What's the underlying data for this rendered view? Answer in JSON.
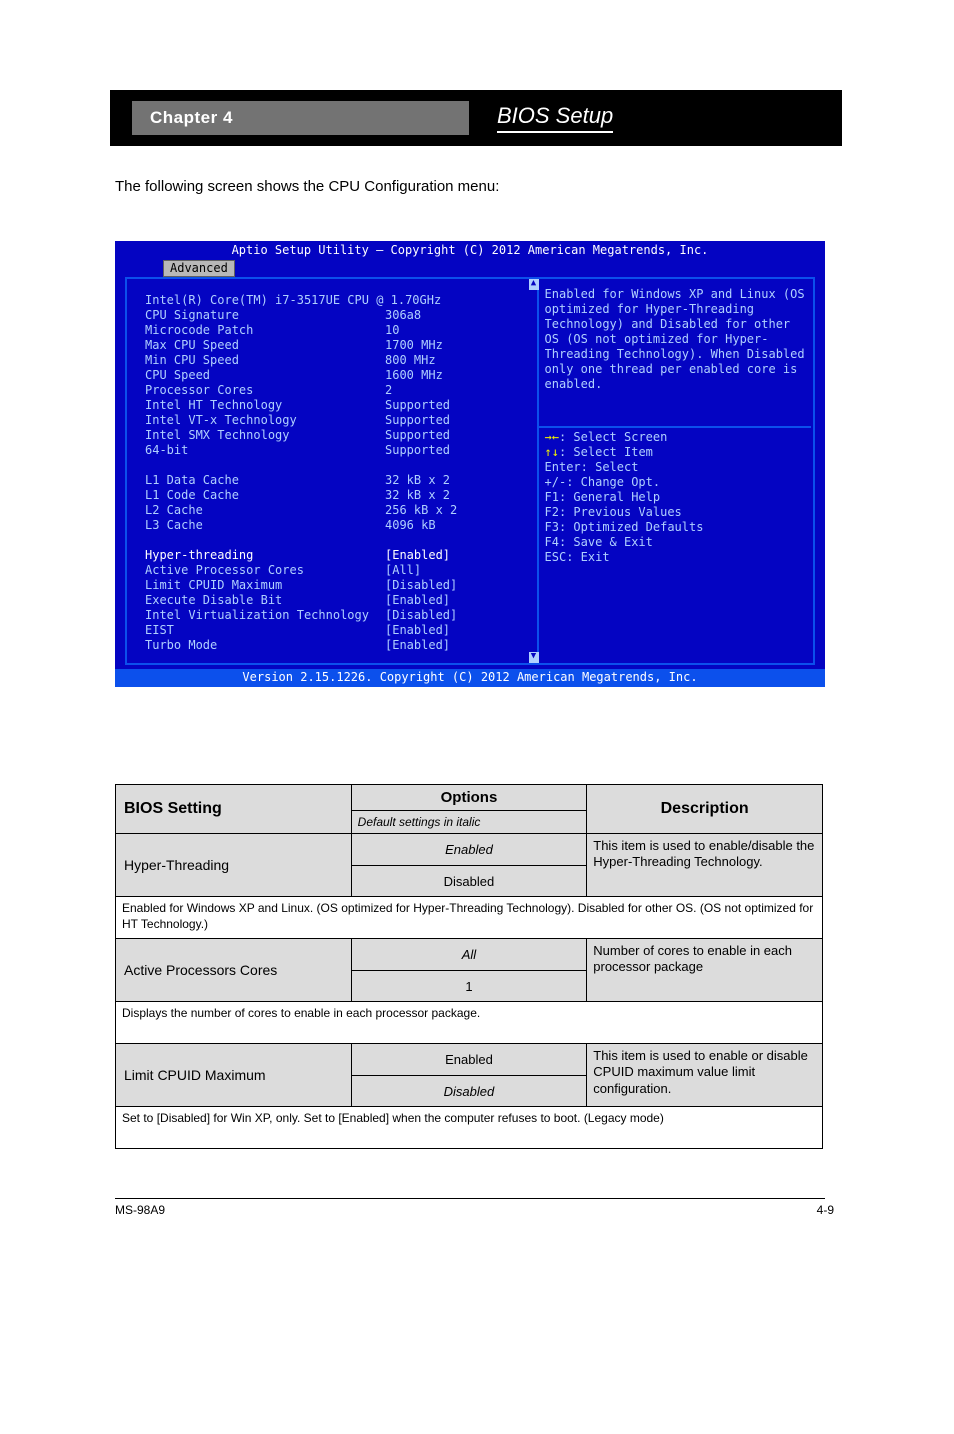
{
  "header": {
    "chapter": "Chapter 4",
    "section": "BIOS Setup"
  },
  "intro": "The following screen shows the CPU Configuration menu:",
  "bios": {
    "title": "Aptio Setup Utility – Copyright (C) 2012 American Megatrends, Inc.",
    "tab": "Advanced",
    "cpu_name": "Intel(R) Core(TM) i7-3517UE CPU @ 1.70GHz",
    "rows_info": [
      {
        "label": "CPU Signature",
        "value": "306a8"
      },
      {
        "label": "Microcode Patch",
        "value": "10"
      },
      {
        "label": "Max CPU Speed",
        "value": "1700 MHz"
      },
      {
        "label": "Min CPU Speed",
        "value": "800 MHz"
      },
      {
        "label": "CPU Speed",
        "value": "1600 MHz"
      },
      {
        "label": "Processor Cores",
        "value": "2"
      },
      {
        "label": "Intel HT Technology",
        "value": "Supported"
      },
      {
        "label": "Intel VT-x Technology",
        "value": "Supported"
      },
      {
        "label": "Intel SMX Technology",
        "value": "Supported"
      },
      {
        "label": "64-bit",
        "value": "Supported"
      }
    ],
    "rows_cache": [
      {
        "label": "L1 Data Cache",
        "value": "32 kB x 2"
      },
      {
        "label": "L1 Code Cache",
        "value": "32 kB x 2"
      },
      {
        "label": "L2 Cache",
        "value": "256 kB x 2"
      },
      {
        "label": "L3 Cache",
        "value": "4096 kB"
      }
    ],
    "rows_settings": [
      {
        "label": "Hyper-threading",
        "value": "[Enabled]"
      },
      {
        "label": "Active Processor Cores",
        "value": "[All]"
      },
      {
        "label": "Limit CPUID Maximum",
        "value": "[Disabled]"
      },
      {
        "label": "Execute Disable Bit",
        "value": "[Enabled]"
      },
      {
        "label": "Intel Virtualization Technology",
        "value": "[Disabled]"
      },
      {
        "label": "EIST",
        "value": "[Enabled]"
      },
      {
        "label": "Turbo Mode",
        "value": "[Enabled]"
      }
    ],
    "help": "Enabled for Windows XP and Linux (OS optimized for Hyper-Threading Technology) and Disabled for other OS (OS not optimized for Hyper-Threading Technology). When Disabled only one thread per enabled core is enabled.",
    "keys": [
      "→←: Select Screen",
      "↑↓: Select Item",
      "Enter: Select",
      "+/-: Change Opt.",
      "F1: General Help",
      "F2: Previous Values",
      "F3: Optimized Defaults",
      "F4: Save & Exit",
      "ESC: Exit"
    ],
    "footer": "Version 2.15.1226. Copyright (C) 2012 American Megatrends, Inc."
  },
  "table": {
    "headers": {
      "bios": "BIOS Setting",
      "options": "Options",
      "options_sub": "Default settings in italic",
      "desc": "Description"
    },
    "rows": [
      {
        "name": "Hyper-Threading",
        "opts": [
          "Enabled",
          "Disabled"
        ],
        "default_idx": 0,
        "desc": "This item is used to enable/disable the Hyper-Threading Technology."
      },
      {
        "long_desc": "Enabled for Windows XP and Linux. (OS optimized for Hyper-Threading Technology). Disabled for other OS. (OS not optimized for HT Technology.)"
      },
      {
        "name": "Active Processors Cores",
        "opts": [
          "All",
          "1"
        ],
        "default_idx": 0,
        "desc": "Number of cores to enable in each processor package"
      },
      {
        "long_desc": "Displays the number of cores to enable in each processor package."
      },
      {
        "name": "Limit CPUID Maximum",
        "opts": [
          "Enabled",
          "Disabled"
        ],
        "default_idx": 1,
        "desc": "This item is used to enable or disable CPUID maximum value limit configuration."
      },
      {
        "long_desc": "Set to [Disabled] for Win XP, only. Set to [Enabled] when the computer refuses to boot. (Legacy mode)"
      }
    ]
  },
  "footer": {
    "left": "MS-98A9",
    "right": "4-9"
  }
}
